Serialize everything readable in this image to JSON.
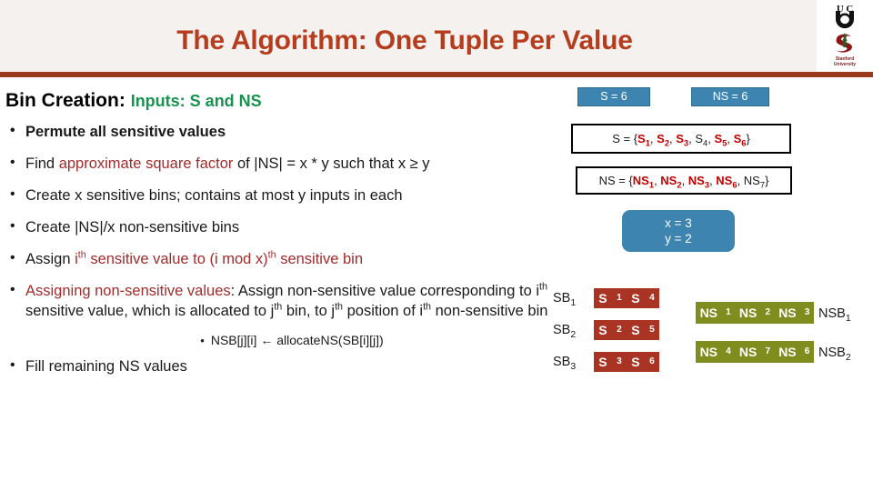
{
  "slide": {
    "title": "The Algorithm: One Tuple Per Value"
  },
  "logos": {
    "uci": "uci-logo",
    "stanford": "stanford-logo",
    "stanford_caption_line1": "Stanford",
    "stanford_caption_line2": "University"
  },
  "left": {
    "heading_black": "Bin Creation:",
    "heading_green": "Inputs: S and NS",
    "bullets": [
      {
        "id": "permute",
        "style": "red",
        "html": "Permute all sensitive values"
      },
      {
        "id": "square-factor",
        "style": "mixed",
        "html": "Find <span class=\"redtx\">approximate square factor</span> of |NS| = x * y such that x &#8805; y"
      },
      {
        "id": "create-sensitive-bins",
        "style": "plain",
        "html": "Create x sensitive bins; contains at most y inputs in each"
      },
      {
        "id": "create-nonsensitive-bins",
        "style": "plain",
        "html": "Create |NS|/x non-sensitive bins"
      },
      {
        "id": "assign-sensitive",
        "style": "mixed",
        "html": "Assign <span class=\"redtx\">i<sup>th</sup> sensitive value to (i mod  x)<sup>th</sup> sensitive bin</span>"
      },
      {
        "id": "assign-nonsensitive",
        "style": "mixed",
        "html": "<span class=\"redtx\">Assigning non-sensitive values</span>: Assign non-sensitive value corresponding to i<sup>th</sup> sensitive value, which is allocated to j<sup>th</sup> bin, to j<sup>th</sup> position of i<sup>th</sup> non-sensitive bin"
      }
    ],
    "sub_bullet": "NSB[j][i] ← allocateNS(SB[i][j])",
    "final_bullet": "Fill remaining NS values"
  },
  "right": {
    "badges": [
      {
        "id": "s-count",
        "label": "S = 6"
      },
      {
        "id": "ns-count",
        "label": "NS = 6"
      }
    ],
    "set_s": {
      "prefix": "S = {",
      "suffix": "}",
      "items": [
        {
          "base": "S",
          "sub": "1",
          "highlight": true
        },
        {
          "base": "S",
          "sub": "2",
          "highlight": true
        },
        {
          "base": "S",
          "sub": "3",
          "highlight": true
        },
        {
          "base": "S",
          "sub": "4",
          "highlight": false
        },
        {
          "base": "S",
          "sub": "5",
          "highlight": true
        },
        {
          "base": "S",
          "sub": "6",
          "highlight": true
        }
      ]
    },
    "set_ns": {
      "prefix": "NS = {",
      "suffix": "}",
      "items": [
        {
          "base": "NS",
          "sub": "1",
          "highlight": true
        },
        {
          "base": "NS",
          "sub": "2",
          "highlight": true
        },
        {
          "base": "NS",
          "sub": "3",
          "highlight": true
        },
        {
          "base": "NS",
          "sub": "6",
          "highlight": true
        },
        {
          "base": "NS",
          "sub": "7",
          "highlight": false
        }
      ]
    },
    "factors": {
      "x": "x = 3",
      "y": "y = 2"
    },
    "sensitive_bins": [
      {
        "label": "SB",
        "label_sub": "1",
        "values": [
          {
            "base": "S",
            "sub": "1"
          },
          {
            "base": "S",
            "sub": "4"
          }
        ]
      },
      {
        "label": "SB",
        "label_sub": "2",
        "values": [
          {
            "base": "S",
            "sub": "2"
          },
          {
            "base": "S",
            "sub": "5"
          }
        ]
      },
      {
        "label": "SB",
        "label_sub": "3",
        "values": [
          {
            "base": "S",
            "sub": "3"
          },
          {
            "base": "S",
            "sub": "6"
          }
        ]
      }
    ],
    "nonsensitive_bins": [
      {
        "label": "NSB",
        "label_sub": "1",
        "values": [
          {
            "base": "NS",
            "sub": "1"
          },
          {
            "base": "NS",
            "sub": "2"
          },
          {
            "base": "NS",
            "sub": "3"
          }
        ]
      },
      {
        "label": "NSB",
        "label_sub": "2",
        "values": [
          {
            "base": "NS",
            "sub": "4"
          },
          {
            "base": "NS",
            "sub": "7"
          },
          {
            "base": "NS",
            "sub": "6"
          }
        ]
      }
    ]
  },
  "colors": {
    "title": "#b53c1d",
    "header_band": "#f5f1ee",
    "header_rule": "#9c3a1e",
    "green_heading": "#17924f",
    "red_text": "#a02c2c",
    "badge_blue": "#3d85b0",
    "bin_red": "#a93423",
    "bin_olive": "#7f8c1e",
    "set_highlight": "#c00000"
  }
}
